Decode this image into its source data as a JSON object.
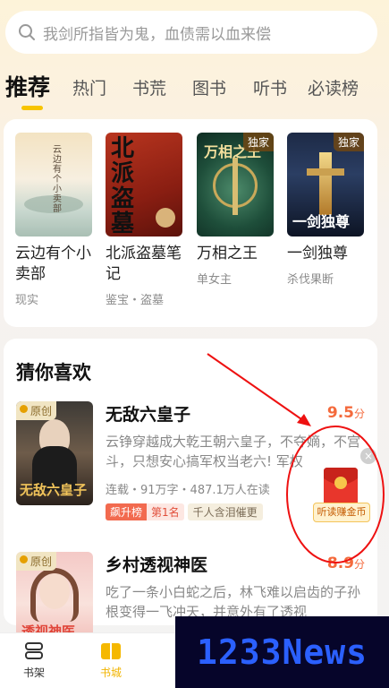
{
  "search": {
    "placeholder": "我剑所指皆为鬼，血债需以血来偿"
  },
  "tabs": [
    {
      "label": "推荐",
      "active": true
    },
    {
      "label": "热门"
    },
    {
      "label": "书荒"
    },
    {
      "label": "图书"
    },
    {
      "label": "听书"
    },
    {
      "label": "必读榜"
    }
  ],
  "recommend": [
    {
      "title": "云边有个小卖部",
      "sub": "现实",
      "badge": "",
      "cover_text": "云边有个小卖部"
    },
    {
      "title": "北派盗墓笔记",
      "sub": "鉴宝・盗墓",
      "badge": "",
      "cover_text": "北派盗墓"
    },
    {
      "title": "万相之王",
      "sub": "单女主",
      "badge": "独家",
      "cover_text": "万相之王"
    },
    {
      "title": "一剑独尊",
      "sub": "杀伐果断",
      "badge": "独家",
      "cover_text": "一剑独尊"
    }
  ],
  "guess": {
    "title": "猜你喜欢",
    "items": [
      {
        "title": "无敌六皇子",
        "score": "9.5",
        "score_unit": "分",
        "badge": "原创",
        "cover_text": "无敌六皇子",
        "desc": "云铮穿越成大乾王朝六皇子，不夺嫡，不宫斗，只想安心搞军权当老六! 军权",
        "meta": "连载・91万字・487.1万人在读",
        "rank_tag": "飙升榜",
        "rank_pos": "第1名",
        "tag": "千人含泪催更"
      },
      {
        "title": "乡村透视神医",
        "score": "8.9",
        "score_unit": "分",
        "badge": "原创",
        "cover_text": "透视神医",
        "desc": "吃了一条小白蛇之后，林飞难以启齿的子孙根变得一飞冲天，并意外有了透视",
        "meta": "",
        "rank_tag": "",
        "rank_pos": "",
        "tag": ""
      }
    ]
  },
  "float_widget": {
    "label": "听读赚金币",
    "close": "×"
  },
  "bottom_nav": [
    {
      "label": "书架",
      "icon": "bookshelf-icon"
    },
    {
      "label": "书城",
      "icon": "bookstore-icon",
      "active": true
    }
  ],
  "watermark": "1233News",
  "colors": {
    "accent": "#f7c400",
    "score": "#f46a3c",
    "rank": "#f26a4f"
  }
}
